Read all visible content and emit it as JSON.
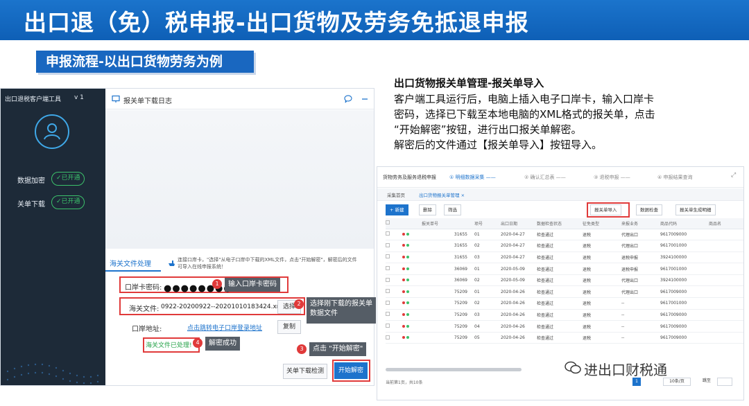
{
  "banner": {
    "title": "出口退（免）税申报-出口货物及劳务免抵退申报"
  },
  "section": {
    "tag": "申报流程-以出口货物劳务为例"
  },
  "client_app": {
    "side_title": "出口退税客户端工具",
    "version": "v 1",
    "status_rows": [
      {
        "label": "数据加密",
        "status": "✓已开通"
      },
      {
        "label": "关单下载",
        "status": "✓已开通"
      }
    ],
    "pane_title": "报关单下载日志",
    "process_tab": "海关文件处理",
    "note": "连接口岸卡，\"选择\"从电子口岸中下载的XML文件，点击\"开始解密\"，解密后的文件可导入在线申报系统！",
    "password_label": "口岸卡密码:",
    "password_value": "●●●●●●●●",
    "file_label": "海关文件:",
    "file_value": "0922-20200922--20201010183424.xml",
    "select_button": "选择",
    "port_label": "口岸地址:",
    "port_link": "点击跳转电子口岸登录地址",
    "copy_button": "复制",
    "done_text": "海关文件已处理!",
    "check_button": "关单下载检测",
    "start_button": "开始解密"
  },
  "callouts": [
    {
      "num": "1",
      "text": "输入口岸卡密码"
    },
    {
      "num": "2",
      "text": "选择刚下载的报关单",
      "text2": "数据文件"
    },
    {
      "num": "3",
      "text": "点击 \"开始解密\""
    },
    {
      "num": "4",
      "text": "解密成功"
    }
  ],
  "description": {
    "title": "出口货物报关单管理-报关单导入",
    "lines": [
      "客户端工具运行后，电脑上插入电子口岸卡，输入口岸卡",
      "密码，选择已下载至本地电脑的XML格式的报关单，点击",
      "“开始解密”按钮，进行出口报关单解密。",
      "解密后的文件通过【报关单导入】按钮导入。"
    ]
  },
  "web_app": {
    "breadcrumb": "货物劳务及服务退税申报",
    "steps": [
      "明细数据采集",
      "确认汇总表",
      "退税申报",
      "申报结果查询"
    ],
    "tabs": [
      "采集首页",
      "出口货物报关单管理 ×"
    ],
    "toolbar": {
      "new": "+ 新建",
      "delete": "删除",
      "filter": "筛选",
      "import": "报关单导入",
      "check": "数据检查",
      "generate": "报关单生成明细"
    },
    "columns": [
      "报关单号",
      "项号",
      "出口日期",
      "数据检查状态",
      "征免类型",
      "来报业务",
      "商品代码",
      "商品名"
    ],
    "rows": [
      [
        "31655",
        "01",
        "2020-04-27",
        "检查通过",
        "退税",
        "代理出口",
        "9617009000"
      ],
      [
        "31655",
        "02",
        "2020-04-27",
        "检查通过",
        "退税",
        "代理出口",
        "9617001000"
      ],
      [
        "31655",
        "03",
        "2020-04-27",
        "检查通过",
        "退税",
        "退税申报",
        "3924100000"
      ],
      [
        "36069",
        "01",
        "2020-05-09",
        "检查通过",
        "退税",
        "退税申报",
        "9617001000"
      ],
      [
        "36069",
        "02",
        "2020-05-09",
        "检查通过",
        "退税",
        "代理出口",
        "3924100000"
      ],
      [
        "75209",
        "01",
        "2020-04-26",
        "检查通过",
        "退税",
        "代理出口",
        "9617009000"
      ],
      [
        "75209",
        "02",
        "2020-04-26",
        "检查通过",
        "退税",
        "--",
        "9617001000"
      ],
      [
        "75209",
        "03",
        "2020-04-26",
        "检查通过",
        "退税",
        "--",
        "9617009000"
      ],
      [
        "75209",
        "04",
        "2020-04-26",
        "检查通过",
        "退税",
        "--",
        "9617009000"
      ],
      [
        "75209",
        "05",
        "2020-04-26",
        "检查通过",
        "退税",
        "--",
        "9617009000"
      ]
    ],
    "footer": "当前第1页，共10条",
    "page": "1",
    "page_size": "10条/页",
    "goto_label": "跳至"
  },
  "watermark": "进出口财税通"
}
